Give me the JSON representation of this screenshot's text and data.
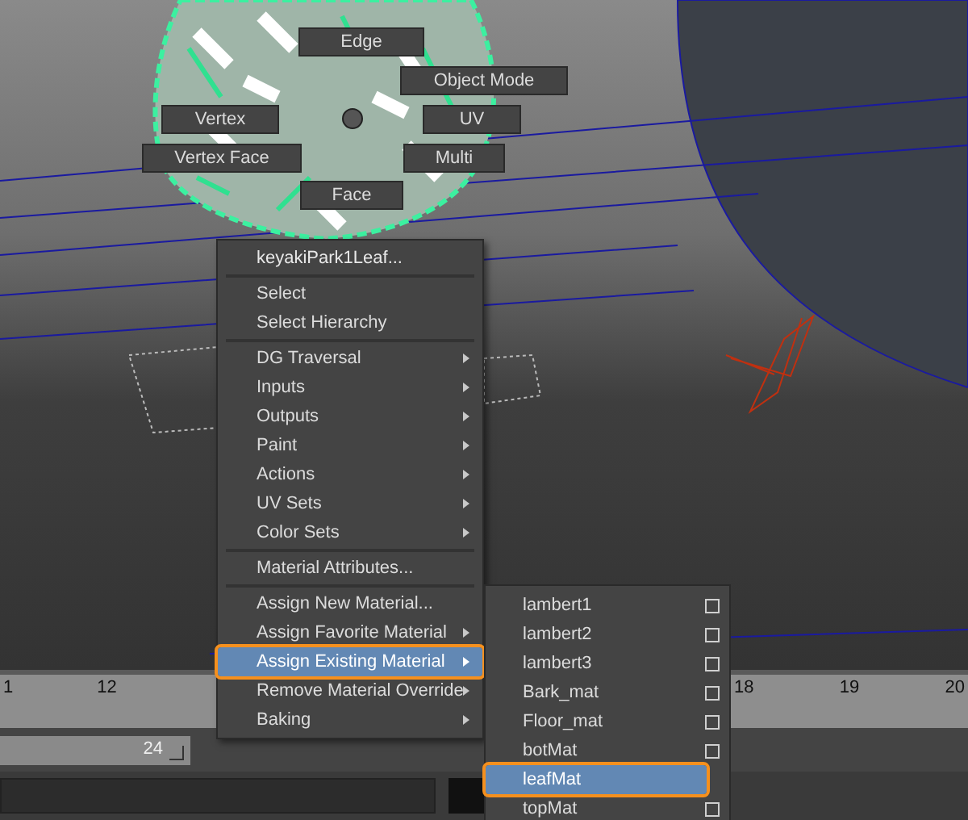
{
  "marking_menu": [
    {
      "label": "Edge",
      "kind": "edge"
    },
    {
      "label": "Object Mode",
      "kind": "object"
    },
    {
      "label": "Vertex",
      "kind": "vertex"
    },
    {
      "label": "UV",
      "kind": "uv"
    },
    {
      "label": "Vertex Face",
      "kind": "vertexface"
    },
    {
      "label": "Multi",
      "kind": "multi"
    },
    {
      "label": "Face",
      "kind": "face"
    }
  ],
  "context_menu": {
    "title": "keyakiPark1Leaf...",
    "items": [
      {
        "kind": "separator"
      },
      {
        "kind": "item",
        "label": "Select",
        "has_submenu": false,
        "selected": false
      },
      {
        "kind": "item",
        "label": "Select Hierarchy",
        "has_submenu": false,
        "selected": false
      },
      {
        "kind": "separator"
      },
      {
        "kind": "item",
        "label": "DG Traversal",
        "has_submenu": true,
        "selected": false
      },
      {
        "kind": "item",
        "label": "Inputs",
        "has_submenu": true,
        "selected": false
      },
      {
        "kind": "item",
        "label": "Outputs",
        "has_submenu": true,
        "selected": false
      },
      {
        "kind": "item",
        "label": "Paint",
        "has_submenu": true,
        "selected": false
      },
      {
        "kind": "item",
        "label": "Actions",
        "has_submenu": true,
        "selected": false
      },
      {
        "kind": "item",
        "label": "UV Sets",
        "has_submenu": true,
        "selected": false
      },
      {
        "kind": "item",
        "label": "Color Sets",
        "has_submenu": true,
        "selected": false
      },
      {
        "kind": "separator"
      },
      {
        "kind": "item",
        "label": "Material Attributes...",
        "has_submenu": false,
        "selected": false
      },
      {
        "kind": "separator"
      },
      {
        "kind": "item",
        "label": "Assign New Material...",
        "has_submenu": false,
        "selected": false
      },
      {
        "kind": "item",
        "label": "Assign Favorite Material",
        "has_submenu": true,
        "selected": false
      },
      {
        "kind": "item",
        "label": "Assign Existing Material",
        "has_submenu": true,
        "selected": true
      },
      {
        "kind": "item",
        "label": "Remove Material Override",
        "has_submenu": true,
        "selected": false
      },
      {
        "kind": "item",
        "label": "Baking",
        "has_submenu": true,
        "selected": false
      }
    ]
  },
  "submenu": {
    "items": [
      {
        "label": "lambert1",
        "selected": false
      },
      {
        "label": "lambert2",
        "selected": false
      },
      {
        "label": "lambert3",
        "selected": false
      },
      {
        "label": "Bark_mat",
        "selected": false
      },
      {
        "label": "Floor_mat",
        "selected": false
      },
      {
        "label": "botMat",
        "selected": false
      },
      {
        "label": "leafMat",
        "selected": true
      },
      {
        "label": "topMat",
        "selected": false
      }
    ]
  },
  "time_ruler": {
    "left_labels": [
      "1",
      "12"
    ],
    "right_labels": [
      "18",
      "19",
      "20"
    ]
  },
  "range_slider": {
    "end_value": "24"
  }
}
